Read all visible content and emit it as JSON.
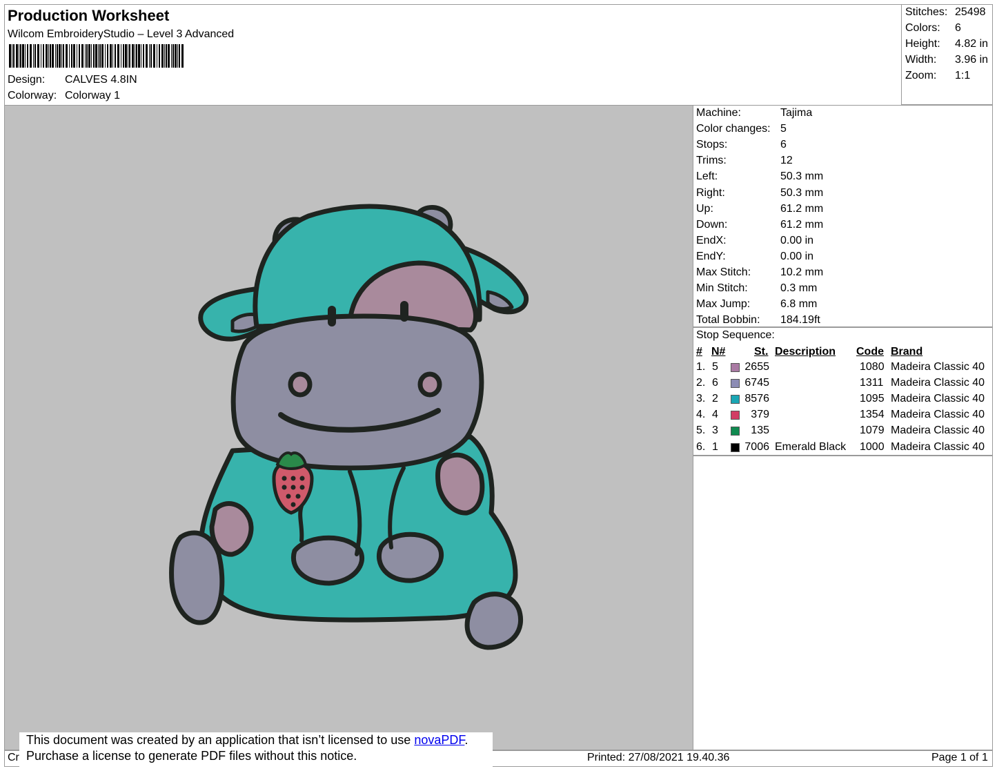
{
  "header": {
    "title": "Production Worksheet",
    "software": "Wilcom EmbroideryStudio – Level 3 Advanced",
    "design_label": "Design:",
    "design_value": "CALVES 4.8IN",
    "colorway_label": "Colorway:",
    "colorway_value": "Colorway 1"
  },
  "stats": [
    {
      "label": "Stitches:",
      "value": "25498"
    },
    {
      "label": "Colors:",
      "value": "6"
    },
    {
      "label": "Height:",
      "value": "4.82 in"
    },
    {
      "label": "Width:",
      "value": "3.96 in"
    },
    {
      "label": "Zoom:",
      "value": "1:1"
    }
  ],
  "machine_info": [
    {
      "label": "Machine:",
      "value": "Tajima"
    },
    {
      "label": "Color changes:",
      "value": "5"
    },
    {
      "label": "Stops:",
      "value": "6"
    },
    {
      "label": "Trims:",
      "value": "12"
    },
    {
      "label": "Left:",
      "value": "50.3 mm"
    },
    {
      "label": "Right:",
      "value": "50.3 mm"
    },
    {
      "label": "Up:",
      "value": "61.2 mm"
    },
    {
      "label": "Down:",
      "value": "61.2 mm"
    },
    {
      "label": "EndX:",
      "value": "0.00 in"
    },
    {
      "label": "EndY:",
      "value": "0.00 in"
    },
    {
      "label": "Max Stitch:",
      "value": "10.2 mm"
    },
    {
      "label": "Min Stitch:",
      "value": "0.3 mm"
    },
    {
      "label": "Max Jump:",
      "value": "6.8 mm"
    },
    {
      "label": "Total Bobbin:",
      "value": "184.19ft"
    }
  ],
  "stop_sequence": {
    "title": "Stop Sequence:",
    "columns": {
      "num": "#",
      "needle": "N#",
      "stitches": "St.",
      "description": "Description",
      "code": "Code",
      "brand": "Brand"
    },
    "rows": [
      {
        "num": "1.",
        "needle": "5",
        "color": "#a97aa3",
        "stitches": "2655",
        "description": "",
        "code": "1080",
        "brand": "Madeira Classic 40"
      },
      {
        "num": "2.",
        "needle": "6",
        "color": "#8c8cb4",
        "stitches": "6745",
        "description": "",
        "code": "1311",
        "brand": "Madeira Classic 40"
      },
      {
        "num": "3.",
        "needle": "2",
        "color": "#1aa6b4",
        "stitches": "8576",
        "description": "",
        "code": "1095",
        "brand": "Madeira Classic 40"
      },
      {
        "num": "4.",
        "needle": "4",
        "color": "#d23c64",
        "stitches": "379",
        "description": "",
        "code": "1354",
        "brand": "Madeira Classic 40"
      },
      {
        "num": "5.",
        "needle": "3",
        "color": "#108a50",
        "stitches": "135",
        "description": "",
        "code": "1079",
        "brand": "Madeira Classic 40"
      },
      {
        "num": "6.",
        "needle": "1",
        "color": "#000000",
        "stitches": "7006",
        "description": "Emerald Black",
        "code": "1000",
        "brand": "Madeira Classic 40"
      }
    ]
  },
  "footer": {
    "created_prefix": "Cr",
    "printed": "Printed: 27/08/2021 19.40.36",
    "page": "Page 1 of 1"
  },
  "notice": {
    "line1": "This document was created by an application that isn’t licensed to use ",
    "link": "novaPDF",
    "line1_end": ".",
    "line2": "Purchase a license to generate PDF files without this notice."
  },
  "colors": {
    "teal": "#37b3ac",
    "lavender": "#8e8ea2",
    "mauve": "#a98a9c",
    "outline": "#1f2420",
    "strawberry": "#cf5a6b",
    "leaf": "#2a8a4a",
    "background": "#c0c0c0"
  }
}
